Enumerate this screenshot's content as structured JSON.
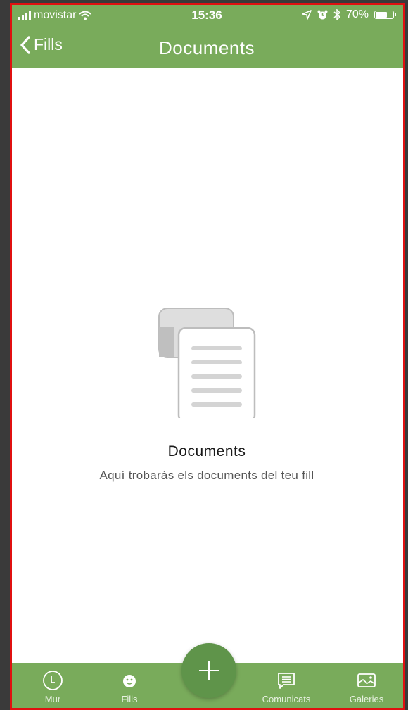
{
  "status_bar": {
    "carrier": "movistar",
    "time": "15:36",
    "battery_percent": "70%",
    "battery_level": 0.7,
    "icons": [
      "signal-icon",
      "wifi-icon",
      "location-icon",
      "alarm-icon",
      "bluetooth-icon",
      "battery-icon"
    ]
  },
  "nav": {
    "back_label": "Fills",
    "title": "Documents"
  },
  "empty_state": {
    "icon": "documents-icon",
    "title": "Documents",
    "subtitle": "Aquí trobaràs els documents del teu fill"
  },
  "tab_bar": {
    "tabs": [
      {
        "label": "Mur",
        "icon": "clock-icon"
      },
      {
        "label": "Fills",
        "icon": "smiley-icon"
      },
      {
        "label": "Comunicats",
        "icon": "message-icon"
      },
      {
        "label": "Galeries",
        "icon": "image-icon"
      }
    ],
    "fab_icon": "plus-icon"
  },
  "colors": {
    "accent": "#79ab5b",
    "fab": "#5f944a",
    "frame_border": "#e01010"
  }
}
